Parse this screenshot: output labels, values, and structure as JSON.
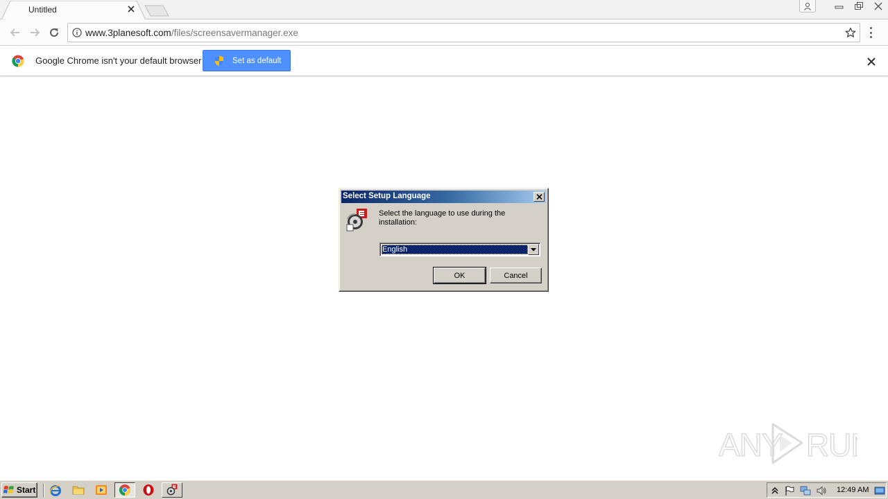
{
  "browser": {
    "tab_title": "Untitled",
    "url_host": "www.3planesoft.com",
    "url_path": "/files/screensavermanager.exe"
  },
  "infobar": {
    "message": "Google Chrome isn't your default browser",
    "button_label": "Set as default"
  },
  "dialog": {
    "title": "Select Setup Language",
    "message": "Select the language to use during the installation:",
    "selected_language": "English",
    "ok_label": "OK",
    "cancel_label": "Cancel"
  },
  "taskbar": {
    "start_label": "Start",
    "clock": "12:49 AM"
  },
  "watermark": {
    "text": "ANY RUN"
  },
  "colors": {
    "infobar_button": "#4d90fe",
    "dialog_title_start": "#0a246a",
    "dialog_title_end": "#a6caf0",
    "dialog_face": "#d4d0c8"
  }
}
